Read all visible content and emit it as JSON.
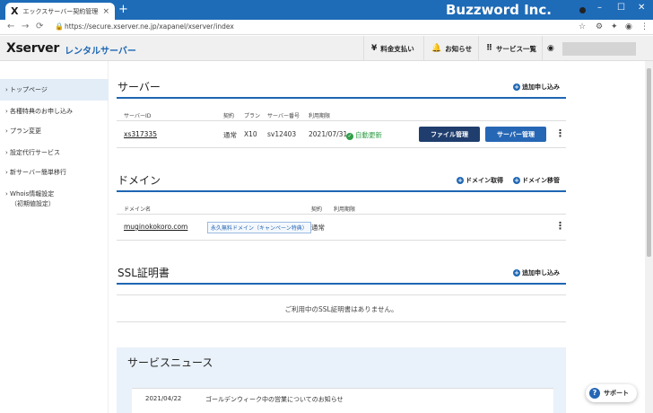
{
  "browser": {
    "tab_title": "エックスサーバー契約管理ページ",
    "tab_favicon": "X",
    "tab_close": "×",
    "new_tab": "+",
    "brand": "Buzzword Inc.",
    "url": "https://secure.xserver.ne.jp/xapanel/xserver/index",
    "win_min": "–",
    "win_max": "☐",
    "win_close": "✕",
    "nav_back": "←",
    "nav_forward": "→",
    "nav_reload": "⟳",
    "lock": "🔒",
    "addr_star": "☆",
    "addr_ext1": "⚙",
    "addr_ext2": "✦",
    "addr_user": "◉",
    "addr_menu": "⋮"
  },
  "header": {
    "logo": "Xserver",
    "logo_sub": "レンタルサーバー",
    "payment": "料金支払い",
    "payment_icon": "¥",
    "notice": "お知らせ",
    "notice_icon": "🔔",
    "services": "サービス一覧",
    "services_icon": "⠿",
    "user_icon": "◉"
  },
  "sidebar": {
    "items": [
      {
        "label": "› トップページ"
      },
      {
        "label": "› 各種特典のお申し込み"
      },
      {
        "label": "› プラン変更"
      },
      {
        "label": "› 設定代行サービス"
      },
      {
        "label": "› 新サーバー簡単移行"
      },
      {
        "label": "› Whois情報設定"
      },
      {
        "label": "（初期値設定）"
      }
    ]
  },
  "server": {
    "title": "サーバー",
    "add": "追加申し込み",
    "plus": "+",
    "cols": {
      "id": "サーバーID",
      "contract": "契約",
      "plan": "プラン",
      "number": "サーバー番号",
      "period": "利用期限"
    },
    "row": {
      "id": "xs317335",
      "contract": "通常",
      "plan": "X10",
      "number": "sv12403",
      "period": "2021/07/31",
      "renew": "自動更新",
      "check": "✓"
    },
    "btn_file": "ファイル管理",
    "btn_server": "サーバー管理",
    "kebab": "⋮"
  },
  "domain": {
    "title": "ドメイン",
    "acquire": "ドメイン取得",
    "transfer": "ドメイン移管",
    "plus": "+",
    "cols": {
      "name": "ドメイン名",
      "contract": "契約",
      "period": "利用期限"
    },
    "row": {
      "name": "muginokokoro.com",
      "badge": "永久無料ドメイン（キャンペーン特典）",
      "contract": "通常"
    },
    "kebab": "⋮"
  },
  "ssl": {
    "title": "SSL証明書",
    "add": "追加申し込み",
    "plus": "+",
    "empty": "ご利用中のSSL証明書はありません。"
  },
  "news": {
    "title": "サービスニュース",
    "date": "2021/04/22",
    "text": "ゴールデンウィーク中の営業についてのお知らせ"
  },
  "support": {
    "label": "サポート",
    "icon": "?"
  }
}
